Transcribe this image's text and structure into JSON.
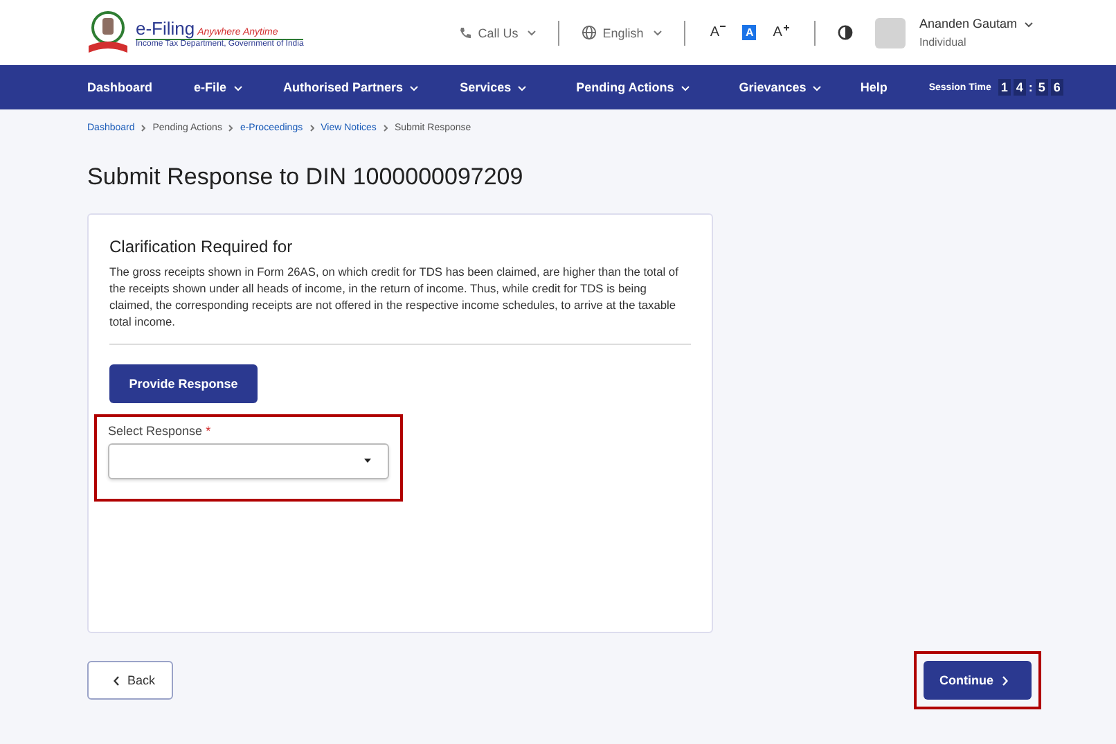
{
  "logo": {
    "title": "e-Filing",
    "tagline": "Anywhere Anytime",
    "subtitle": "Income Tax Department, Government of India"
  },
  "header": {
    "call_us": "Call Us",
    "language": "English",
    "font_sizes": [
      {
        "label": "A",
        "kind": "smaller",
        "selected": false
      },
      {
        "label": "A",
        "kind": "normal",
        "selected": true
      },
      {
        "label": "A",
        "kind": "larger",
        "selected": false
      }
    ],
    "user": {
      "name": "Ananden Gautam",
      "role": "Individual"
    }
  },
  "nav": {
    "items": [
      {
        "label": "Dashboard",
        "has_menu": false
      },
      {
        "label": "e-File",
        "has_menu": true
      },
      {
        "label": "Authorised Partners",
        "has_menu": true
      },
      {
        "label": "Services",
        "has_menu": true
      },
      {
        "label": "Pending Actions",
        "has_menu": true
      },
      {
        "label": "Grievances",
        "has_menu": true
      },
      {
        "label": "Help",
        "has_menu": false
      }
    ],
    "session_label": "Session Time",
    "session_digits": [
      "1",
      "4",
      ":",
      "5",
      "6"
    ]
  },
  "breadcrumb": [
    {
      "label": "Dashboard",
      "link": true
    },
    {
      "label": "Pending Actions",
      "link": false
    },
    {
      "label": "e-Proceedings",
      "link": true
    },
    {
      "label": "View Notices",
      "link": true
    },
    {
      "label": "Submit Response",
      "link": false
    }
  ],
  "page_title": "Submit Response to DIN 1000000097209",
  "card": {
    "heading": "Clarification Required for",
    "text": "The gross receipts shown in Form 26AS, on which credit for TDS has been claimed, are higher than the total of the receipts shown under all heads of income, in the return of income. Thus, while credit for TDS is being claimed, the corresponding receipts are not offered in the respective income schedules, to arrive at the taxable total income.",
    "provide_button": "Provide Response",
    "select": {
      "label": "Select Response",
      "required_mark": "*",
      "highlighted": true
    }
  },
  "back_button": "Back",
  "continue_button": {
    "label": "Continue",
    "highlighted": true
  }
}
